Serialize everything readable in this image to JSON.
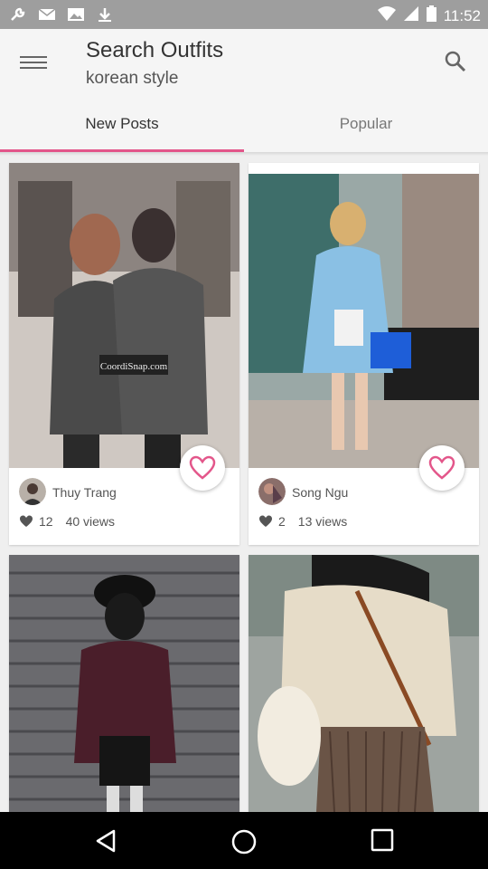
{
  "status_bar": {
    "time": "11:52"
  },
  "header": {
    "title": "Search Outfits",
    "subtitle": "korean style"
  },
  "tabs": [
    {
      "label": "New Posts",
      "active": true
    },
    {
      "label": "Popular",
      "active": false
    }
  ],
  "accent_color": "#e3568a",
  "posts": [
    {
      "author": "Thuy Trang",
      "likes": "12",
      "views": "40 views",
      "photo_watermark": "CoordiSnap.com"
    },
    {
      "author": "Song Ngu",
      "likes": "2",
      "views": "13 views"
    }
  ]
}
